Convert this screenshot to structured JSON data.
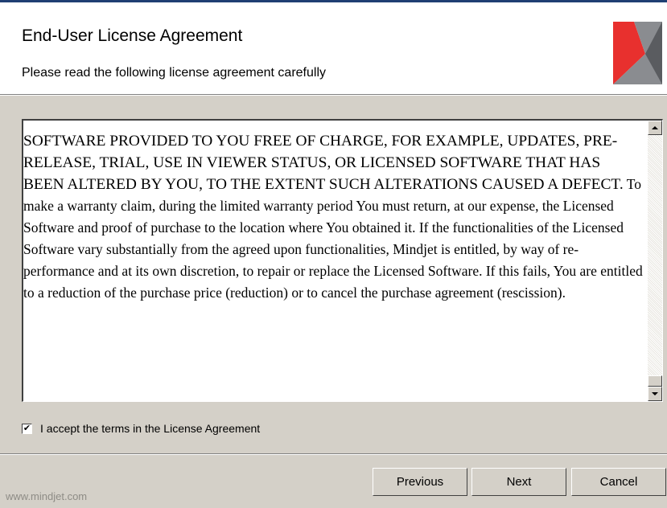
{
  "header": {
    "title": "End-User License Agreement",
    "subtitle": "Please read the following license agreement carefully",
    "logo_icon": "mindjet-logo-icon",
    "logo_colors": {
      "red": "#e8302e",
      "gray": "#8a8c90",
      "dark": "#4a4c50"
    }
  },
  "license": {
    "upper_text": "SOFTWARE PROVIDED TO YOU FREE OF CHARGE, FOR EXAMPLE, UPDATES, PRE-RELEASE, TRIAL, USE IN VIEWER STATUS, OR LICENSED SOFTWARE THAT HAS BEEN ALTERED BY YOU, TO THE EXTENT SUCH ALTERATIONS CAUSED A DEFECT.",
    "body_text": " To make a warranty claim, during the limited warranty period You must return, at our expense, the Licensed Software and proof of purchase to the location where You obtained it.  If the functionalities of the Licensed Software vary substantially from the agreed upon functionalities, Mindjet is entitled, by way of re-performance and at its own discretion, to repair or replace the Licensed Software. If this fails, You are entitled to a reduction of the purchase price (reduction) or to cancel the purchase agreement (rescission)."
  },
  "accept": {
    "label": "I accept the terms in the License Agreement",
    "checked": true,
    "check_glyph": "✔"
  },
  "footer": {
    "link": "www.mindjet.com"
  },
  "buttons": {
    "previous": "Previous",
    "next": "Next",
    "cancel": "Cancel"
  }
}
